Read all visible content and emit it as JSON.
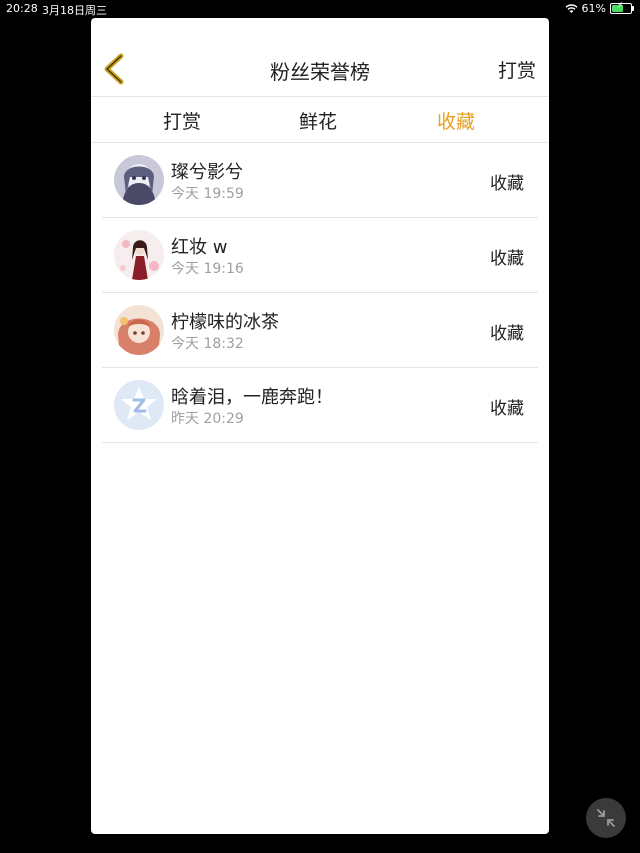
{
  "status_bar": {
    "time": "20:28",
    "date": "3月18日周三",
    "battery_percent": "61%",
    "battery_level": 0.61
  },
  "header": {
    "title": "粉丝荣誉榜",
    "reward_link": "打赏"
  },
  "tabs": [
    {
      "label": "打赏",
      "active": false
    },
    {
      "label": "鲜花",
      "active": false
    },
    {
      "label": "收藏",
      "active": true
    }
  ],
  "fans": [
    {
      "name": "璨兮影兮",
      "time": "今天 19:59",
      "action": "收藏"
    },
    {
      "name": "红妆 w",
      "time": "今天 19:16",
      "action": "收藏"
    },
    {
      "name": "柠檬味的冰茶",
      "time": "今天 18:32",
      "action": "收藏"
    },
    {
      "name": "晗着泪，一鹿奔跑！",
      "time": "昨天 20:29",
      "action": "收藏"
    }
  ],
  "colors": {
    "accent": "#e8a020",
    "back_icon": "#c9a227",
    "text": "#222222",
    "muted": "#a0a0a0"
  }
}
